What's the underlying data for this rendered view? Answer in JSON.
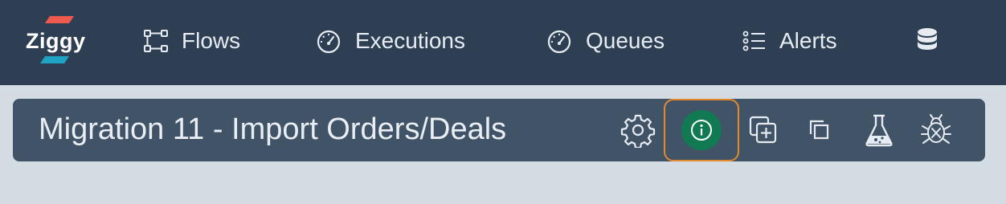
{
  "app": {
    "logo_text": "Ziggy",
    "colors": {
      "nav_bg": "#2e3f53",
      "subbar_bg": "#415367",
      "page_bg": "#d3dbe3",
      "logo_red": "#ef5a4f",
      "logo_teal": "#1fa3c4",
      "info_green": "#117a52",
      "focus_orange": "#e5892c"
    }
  },
  "nav": {
    "items": [
      {
        "label": "Flows",
        "icon": "flow-icon"
      },
      {
        "label": "Executions",
        "icon": "gauge-icon"
      },
      {
        "label": "Queues",
        "icon": "gauge-icon"
      },
      {
        "label": "Alerts",
        "icon": "list-icon"
      }
    ],
    "extra_icon": "database-icon"
  },
  "toolbar": {
    "title": "Migration 11 - Import Orders/Deals",
    "actions": [
      {
        "name": "settings",
        "icon": "gear-icon"
      },
      {
        "name": "info",
        "icon": "info-icon",
        "active": true
      },
      {
        "name": "add-copy",
        "icon": "add-copy-icon"
      },
      {
        "name": "duplicate",
        "icon": "copy-icon"
      },
      {
        "name": "test",
        "icon": "flask-icon"
      },
      {
        "name": "debug",
        "icon": "bug-icon"
      }
    ]
  }
}
